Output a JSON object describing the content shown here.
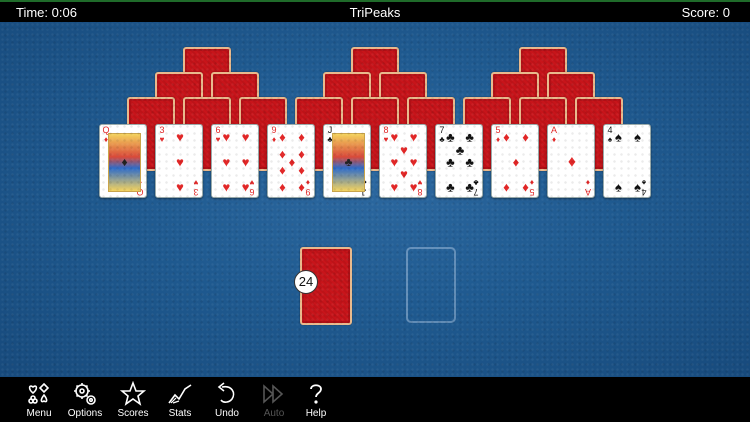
{
  "header": {
    "time": "Time: 0:06",
    "title": "TriPeaks",
    "score": "Score: 0"
  },
  "peaks": {
    "row1_backs": 3,
    "row2_backs": 6,
    "row3_backs": 9
  },
  "faceup_row": [
    {
      "rank": "Q",
      "suit": "♦",
      "color": "red",
      "court": true
    },
    {
      "rank": "3",
      "suit": "♥",
      "color": "red"
    },
    {
      "rank": "6",
      "suit": "♥",
      "color": "red"
    },
    {
      "rank": "9",
      "suit": "♦",
      "color": "red"
    },
    {
      "rank": "J",
      "suit": "♣",
      "color": "blk",
      "court": true
    },
    {
      "rank": "8",
      "suit": "♥",
      "color": "red"
    },
    {
      "rank": "7",
      "suit": "♣",
      "color": "blk"
    },
    {
      "rank": "5",
      "suit": "♦",
      "color": "red"
    },
    {
      "rank": "A",
      "suit": "♦",
      "color": "red"
    },
    {
      "rank": "4",
      "suit": "♠",
      "color": "blk"
    }
  ],
  "stock": {
    "count": "24"
  },
  "toolbar": {
    "menu": "Menu",
    "options": "Options",
    "scores": "Scores",
    "stats": "Stats",
    "undo": "Undo",
    "auto": "Auto",
    "help": "Help"
  },
  "colors": {
    "felt": "#1f5a90",
    "card_back": "#c8141a",
    "card_back_border": "#e9b98c"
  }
}
